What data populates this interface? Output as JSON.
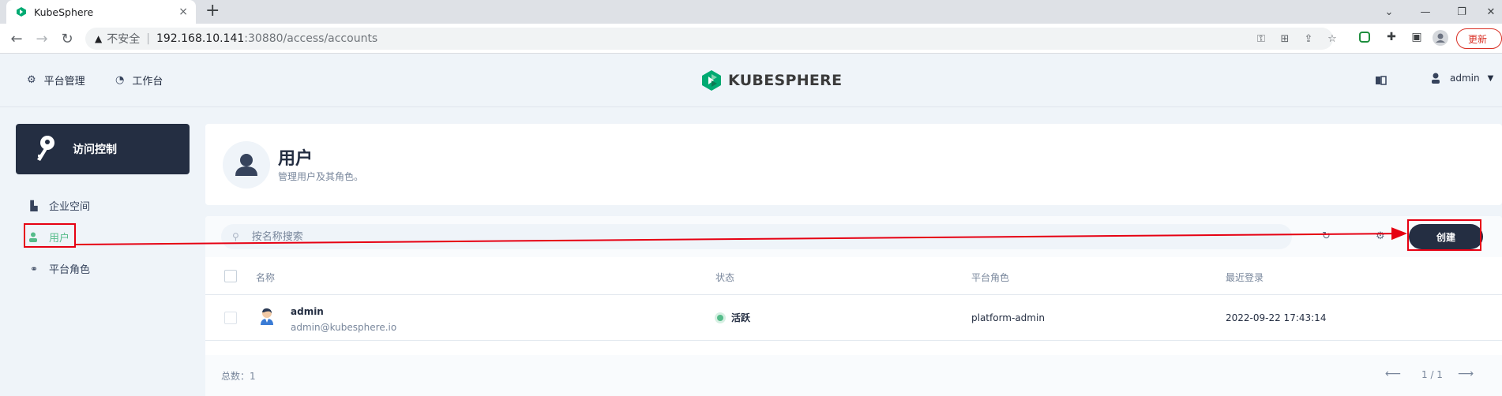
{
  "browser": {
    "tab_title": "KubeSphere",
    "tab_close": "×",
    "new_tab": "+",
    "security_label": "不安全",
    "url_host": "192.168.10.141",
    "url_path": ":30880/access/accounts",
    "update_label": "更新"
  },
  "header": {
    "platform_admin": "平台管理",
    "workbench": "工作台",
    "logo_text": "KUBESPHERE",
    "username": "admin"
  },
  "sidebar": {
    "section_title": "访问控制",
    "items": [
      {
        "label": "企业空间",
        "icon": "workspace-icon",
        "active": false
      },
      {
        "label": "用户",
        "icon": "user-icon",
        "active": true
      },
      {
        "label": "平台角色",
        "icon": "role-icon",
        "active": false
      }
    ]
  },
  "page": {
    "title": "用户",
    "description": "管理用户及其角色。"
  },
  "toolbar": {
    "search_placeholder": "按名称搜索",
    "create_label": "创建"
  },
  "table": {
    "columns": [
      "名称",
      "状态",
      "平台角色",
      "最近登录"
    ],
    "rows": [
      {
        "name": "admin",
        "email": "admin@kubesphere.io",
        "status": "活跃",
        "role": "platform-admin",
        "last_login": "2022-09-22 17:43:14"
      }
    ]
  },
  "footer": {
    "total_label": "总数：",
    "total_count": "1",
    "page_info": "1 / 1"
  },
  "colors": {
    "brand_dark": "#242e42",
    "active_green": "#55bc8a",
    "annotation_red": "#e60012"
  }
}
